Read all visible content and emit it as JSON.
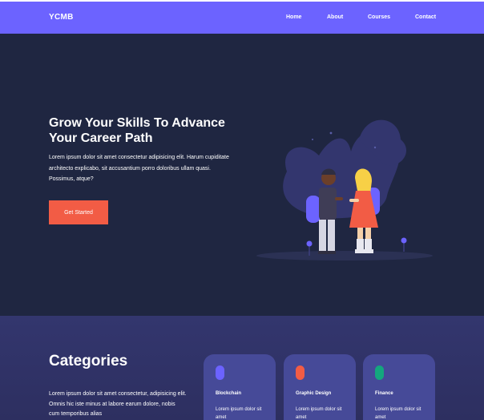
{
  "header": {
    "brand": "YCMB",
    "nav": [
      {
        "label": "Home"
      },
      {
        "label": "About"
      },
      {
        "label": "Courses"
      },
      {
        "label": "Contact"
      }
    ]
  },
  "hero": {
    "title": "Grow Your Skills To Advance Your Career Path",
    "text": "Lorem ipsum dolor sit amet consectetur adipisicing elit. Harum cupiditate architecto explicabo, sit accusantium porro doloribus ullam quasi. Possimus, atque?",
    "cta_label": "Get Started"
  },
  "categories": {
    "title": "Categories",
    "text": "Lorem ipsum dolor sit amet consectetur, adipisicing elit. Omnis hic iste minus at labore earum dolore, nobis cum temporibus alias",
    "cards": [
      {
        "title": "Blockchain",
        "text": "Lorem ipsum dolor sit amet",
        "accent": "#6c63ff"
      },
      {
        "title": "Graphic Design",
        "text": "Lorem ipsum dolor sit amet",
        "accent": "#f25c45"
      },
      {
        "title": "Finance",
        "text": "Lorem ipsum dolor sit amet",
        "accent": "#14a77e"
      }
    ]
  },
  "colors": {
    "nav_bg": "#6c63ff",
    "hero_bg": "#1f2641",
    "cta_bg": "#f25c45",
    "section_bg": "#33366e",
    "card_bg": "#464a98"
  },
  "icons": [
    "two-students-illustration"
  ]
}
